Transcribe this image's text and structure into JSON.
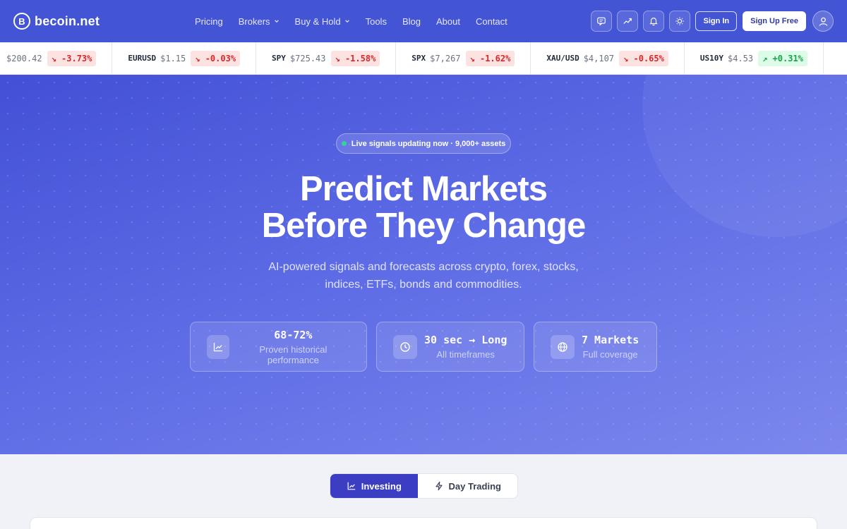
{
  "header": {
    "logo_letter": "B",
    "brand": "becoin.net",
    "nav": [
      {
        "label": "Pricing",
        "dropdown": false
      },
      {
        "label": "Brokers",
        "dropdown": true
      },
      {
        "label": "Buy & Hold",
        "dropdown": true
      },
      {
        "label": "Tools",
        "dropdown": false
      },
      {
        "label": "Blog",
        "dropdown": false
      },
      {
        "label": "About",
        "dropdown": false
      },
      {
        "label": "Contact",
        "dropdown": false
      }
    ],
    "icons": [
      "chat-icon",
      "trending-icon",
      "bell-icon",
      "sun-icon"
    ],
    "sign_in": "Sign In",
    "sign_up": "Sign Up Free"
  },
  "ticker": [
    {
      "symbol": "",
      "price": "$200.42",
      "change": "↘ -3.73%",
      "direction": "down"
    },
    {
      "symbol": "EURUSD",
      "price": "$1.15",
      "change": "↘ -0.03%",
      "direction": "down"
    },
    {
      "symbol": "SPY",
      "price": "$725.43",
      "change": "↘ -1.58%",
      "direction": "down"
    },
    {
      "symbol": "SPX",
      "price": "$7,267",
      "change": "↘ -1.62%",
      "direction": "down"
    },
    {
      "symbol": "XAU/USD",
      "price": "$4,107",
      "change": "↘ -0.65%",
      "direction": "down"
    },
    {
      "symbol": "US10Y",
      "price": "$4.53",
      "change": "↗ +0.31%",
      "direction": "up"
    }
  ],
  "hero": {
    "badge": "Live signals updating now · 9,000+ assets",
    "title_line1": "Predict Markets",
    "title_line2": "Before They Change",
    "subtitle_line1": "AI-powered signals and forecasts across crypto, forex, stocks,",
    "subtitle_line2": "indices, ETFs, bonds and commodities.",
    "stats": [
      {
        "icon": "chart-line-icon",
        "value": "68-72%",
        "label": "Proven historical performance"
      },
      {
        "icon": "clock-icon",
        "value": "30 sec → Long",
        "label": "All timeframes"
      },
      {
        "icon": "globe-icon",
        "value": "7 Markets",
        "label": "Full coverage"
      }
    ]
  },
  "tabs": [
    {
      "label": "Investing",
      "icon": "chart-line-icon",
      "active": true
    },
    {
      "label": "Day Trading",
      "icon": "lightning-icon",
      "active": false
    }
  ],
  "colors": {
    "header_bg": "#4354d5",
    "accent": "#3b3ec3",
    "down": "#dc2626",
    "up": "#16a34a",
    "live_dot": "#34d399"
  }
}
